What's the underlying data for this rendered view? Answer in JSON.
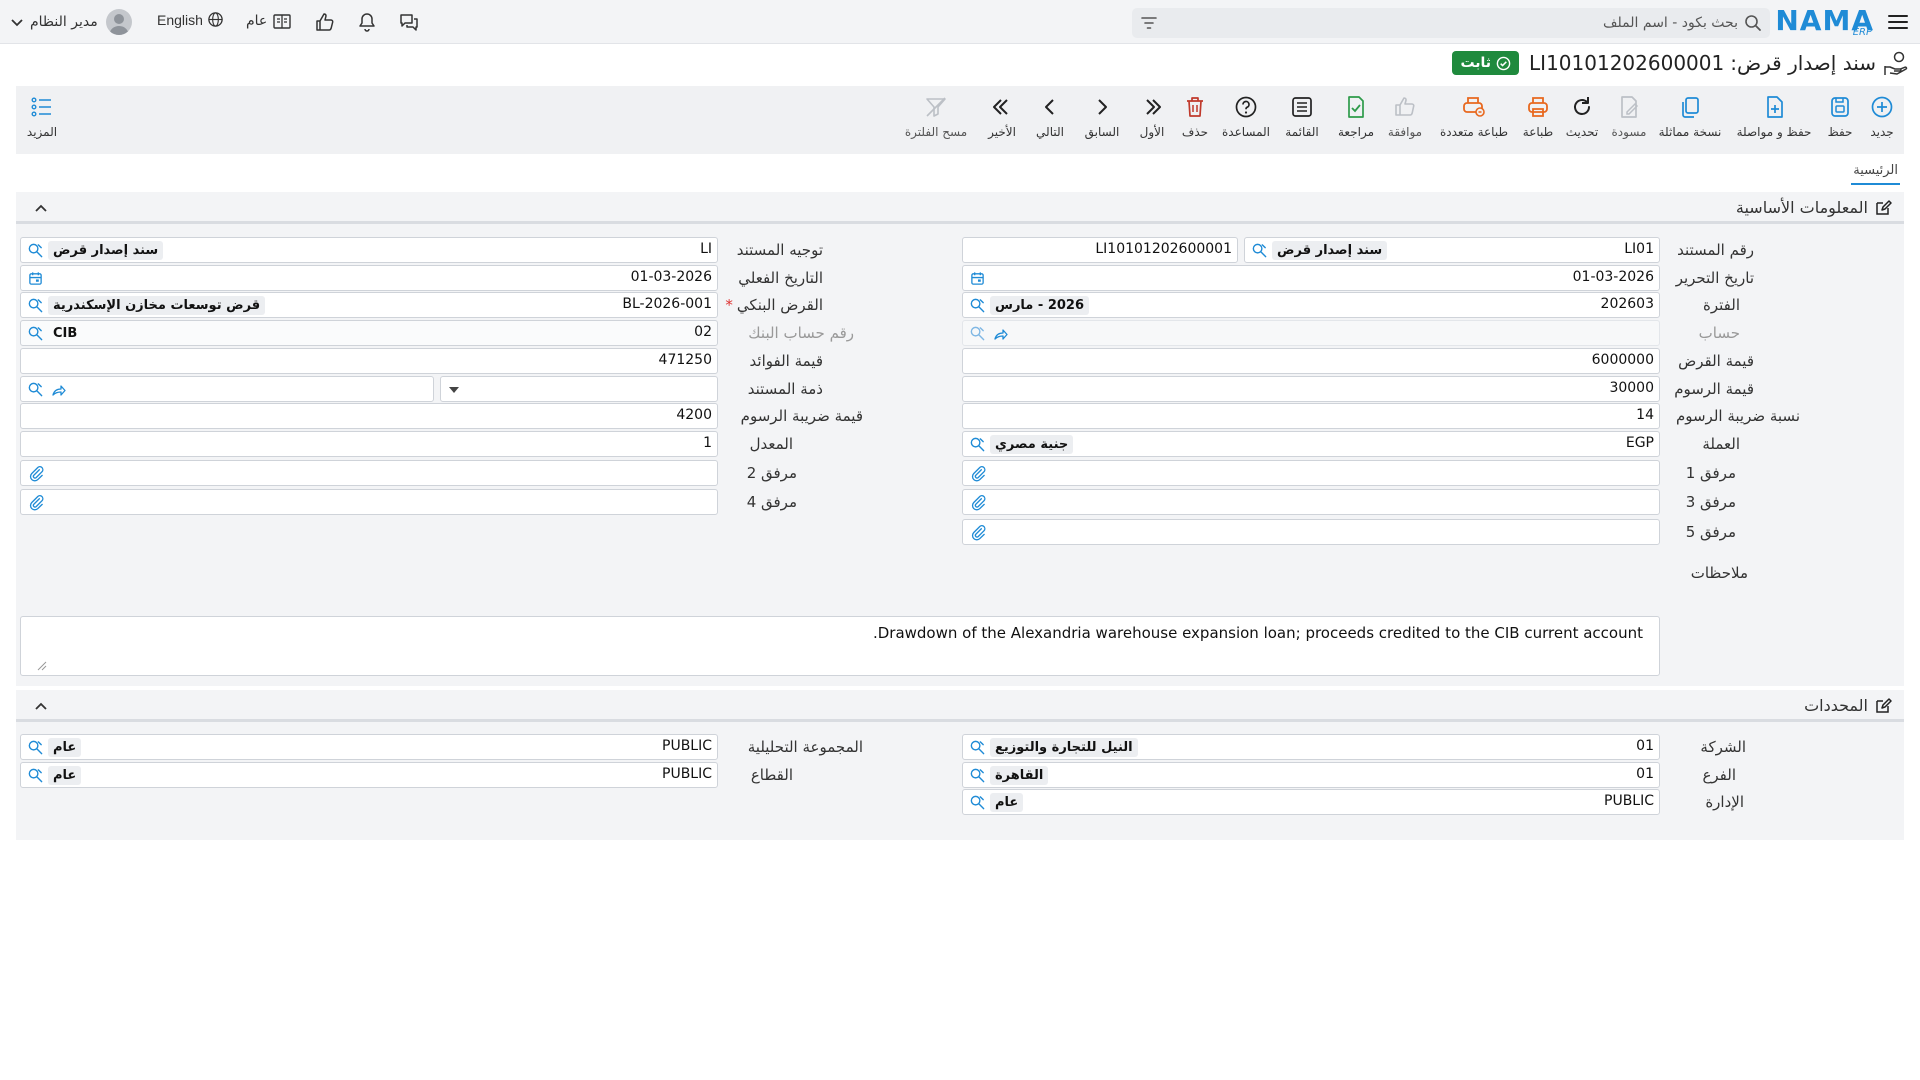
{
  "header": {
    "logo_text": "NAMA",
    "logo_sub": "ERP",
    "search_placeholder": "بحث بكود - اسم الملف",
    "user_name": "مدير النظام",
    "language": "English",
    "fiscal_year_label": "عام"
  },
  "page": {
    "title_label": "سند إصدار قرض:",
    "title_code": "LI10101202600001",
    "status": "ثابت"
  },
  "toolbar": {
    "new": "جديد",
    "save": "حفظ",
    "save_continue": "حفظ و مواصلة",
    "duplicate": "نسخة مماثلة",
    "draft": "مسودة",
    "refresh": "تحديث",
    "print": "طباعة",
    "multi_print": "طباعة متعددة",
    "approve": "موافقة",
    "review": "مراجعة",
    "list": "القائمة",
    "help": "المساعدة",
    "delete": "حذف",
    "first": "الأول",
    "previous": "السابق",
    "next": "التالي",
    "last": "الأخير",
    "clear_filter": "مسح الفلترة",
    "more": "المزيد"
  },
  "tabs": {
    "main": "الرئيسية"
  },
  "basic_section": {
    "title": "المعلومات الأساسية",
    "doc_number_label": "رقم المستند",
    "doc_number_code": "LI01",
    "doc_number_name": "سند إصدار قرض",
    "doc_number_serial": "LI10101202600001",
    "doc_direction_label": "توجيه المستند",
    "doc_direction_code": "LI",
    "doc_direction_name": "سند إصدار قرض",
    "edit_date_label": "تاريخ التحرير",
    "edit_date": "01-03-2026",
    "actual_date_label": "التاريخ الفعلي",
    "actual_date": "01-03-2026",
    "period_label": "الفترة",
    "period_code": "202603",
    "period_name": "2026 - مارس",
    "bank_loan_label": "القرض البنكي",
    "bank_loan_code": "BL-2026-001",
    "bank_loan_name": "قرض توسعات مخازن الإسكندرية",
    "account_label": "حساب",
    "bank_account_label": "رقم حساب البنك",
    "bank_account_code": "02",
    "bank_account_name": "CIB",
    "loan_value_label": "قيمة القرض",
    "loan_value": "6000000",
    "interest_value_label": "قيمة الفوائد",
    "interest_value": "471250",
    "fees_value_label": "قيمة الرسوم",
    "fees_value": "30000",
    "doc_liability_label": "ذمة المستند",
    "fees_tax_rate_label": "نسبة ضريبة الرسوم",
    "fees_tax_rate": "14",
    "fees_tax_value_label": "قيمة ضريبة الرسوم",
    "fees_tax_value": "4200",
    "currency_label": "العملة",
    "currency_code": "EGP",
    "currency_name": "جنية مصري",
    "rate_label": "المعدل",
    "rate": "1",
    "attachment1_label": "مرفق 1",
    "attachment2_label": "مرفق 2",
    "attachment3_label": "مرفق 3",
    "attachment4_label": "مرفق 4",
    "attachment5_label": "مرفق 5",
    "notes_label": "ملاحظات",
    "notes": "Drawdown of the Alexandria warehouse expansion loan; proceeds credited to the CIB current account."
  },
  "determinants_section": {
    "title": "المحددات",
    "company_label": "الشركة",
    "company_code": "01",
    "company_name": "النيل للتجارة والتوزيع",
    "analytic_group_label": "المجموعة التحليلية",
    "analytic_group_code": "PUBLIC",
    "analytic_group_name": "عام",
    "branch_label": "الفرع",
    "branch_code": "01",
    "branch_name": "القاهرة",
    "sector_label": "القطاع",
    "sector_code": "PUBLIC",
    "sector_name": "عام",
    "department_label": "الإدارة",
    "department_code": "PUBLIC",
    "department_name": "عام"
  },
  "colors": {
    "brand": "#1f8bd6",
    "status_green": "#1f8a3d",
    "print_orange": "#e8681e",
    "delete_red": "#c0392b",
    "review_green": "#2e9b4a"
  }
}
